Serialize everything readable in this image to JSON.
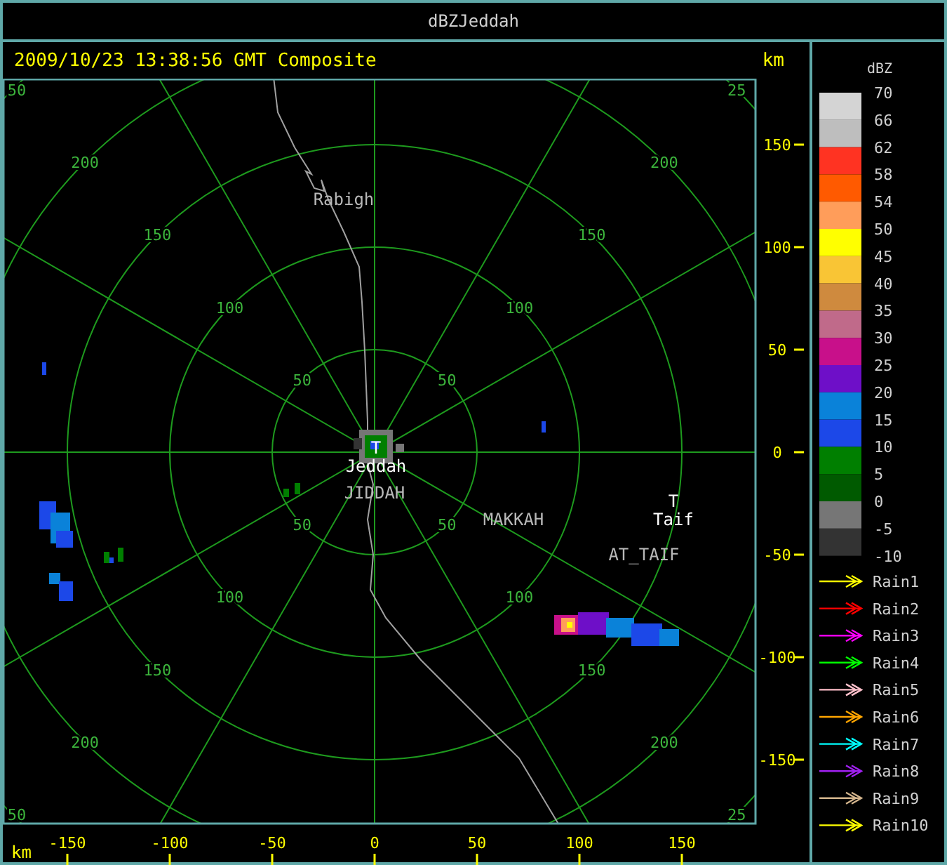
{
  "window": {
    "title": "dBZJeddah"
  },
  "header": {
    "timestamp": "2009/10/23 13:38:56 GMT Composite",
    "unit": "km"
  },
  "map": {
    "range_rings": [
      {
        "labels": [
          "50",
          "50",
          "50",
          "50"
        ]
      },
      {
        "labels": [
          "100",
          "100",
          "100",
          "100"
        ]
      },
      {
        "labels": [
          "150",
          "150",
          "150",
          "150"
        ]
      },
      {
        "labels": [
          "200",
          "200",
          "200",
          "200"
        ]
      },
      {
        "labels": [
          "50",
          "25",
          "50",
          "25"
        ]
      }
    ],
    "places": [
      {
        "name": "Rabigh",
        "kind": "label"
      },
      {
        "name": "Jeddah",
        "kind": "site",
        "marker": "T"
      },
      {
        "name": "JIDDAH",
        "kind": "label"
      },
      {
        "name": "MAKKAH",
        "kind": "label"
      },
      {
        "name": "Taif",
        "kind": "site",
        "marker": "T"
      },
      {
        "name": "AT_TAIF",
        "kind": "label"
      }
    ]
  },
  "y_axis": {
    "ticks": [
      "150",
      "100",
      "50",
      "0",
      "-50",
      "-100",
      "-150"
    ]
  },
  "x_axis": {
    "unit": "km",
    "ticks": [
      "-150",
      "-100",
      "-50",
      "0",
      "50",
      "100",
      "150"
    ]
  },
  "color_scale": {
    "title": "dBZ",
    "bins": [
      {
        "color": "#d4d4d4"
      },
      {
        "color": "#bebebe"
      },
      {
        "color": "#ff3322"
      },
      {
        "color": "#ff5a00"
      },
      {
        "color": "#ff9d5a"
      },
      {
        "color": "#ffff00"
      },
      {
        "color": "#f9c535"
      },
      {
        "color": "#cf8a3e"
      },
      {
        "color": "#c06a8a"
      },
      {
        "color": "#c8108a"
      },
      {
        "color": "#6e0fc8"
      },
      {
        "color": "#0a82d9"
      },
      {
        "color": "#1c48e8"
      },
      {
        "color": "#007f00"
      },
      {
        "color": "#005a00"
      },
      {
        "color": "#767676"
      },
      {
        "color": "#333333"
      }
    ],
    "labels": [
      "70",
      "66",
      "62",
      "58",
      "54",
      "50",
      "45",
      "40",
      "35",
      "30",
      "25",
      "20",
      "15",
      "10",
      "5",
      "0",
      "-5",
      "-10"
    ]
  },
  "tracks": [
    {
      "label": "Rain1",
      "color": "#ffff00"
    },
    {
      "label": "Rain2",
      "color": "#ff0000"
    },
    {
      "label": "Rain3",
      "color": "#ff00ff"
    },
    {
      "label": "Rain4",
      "color": "#00ff00"
    },
    {
      "label": "Rain5",
      "color": "#ffc0cb"
    },
    {
      "label": "Rain6",
      "color": "#ffa500"
    },
    {
      "label": "Rain7",
      "color": "#00ffff"
    },
    {
      "label": "Rain8",
      "color": "#a020f0"
    },
    {
      "label": "Rain9",
      "color": "#d2b48c"
    },
    {
      "label": "Rain10",
      "color": "#ffff00"
    }
  ]
}
